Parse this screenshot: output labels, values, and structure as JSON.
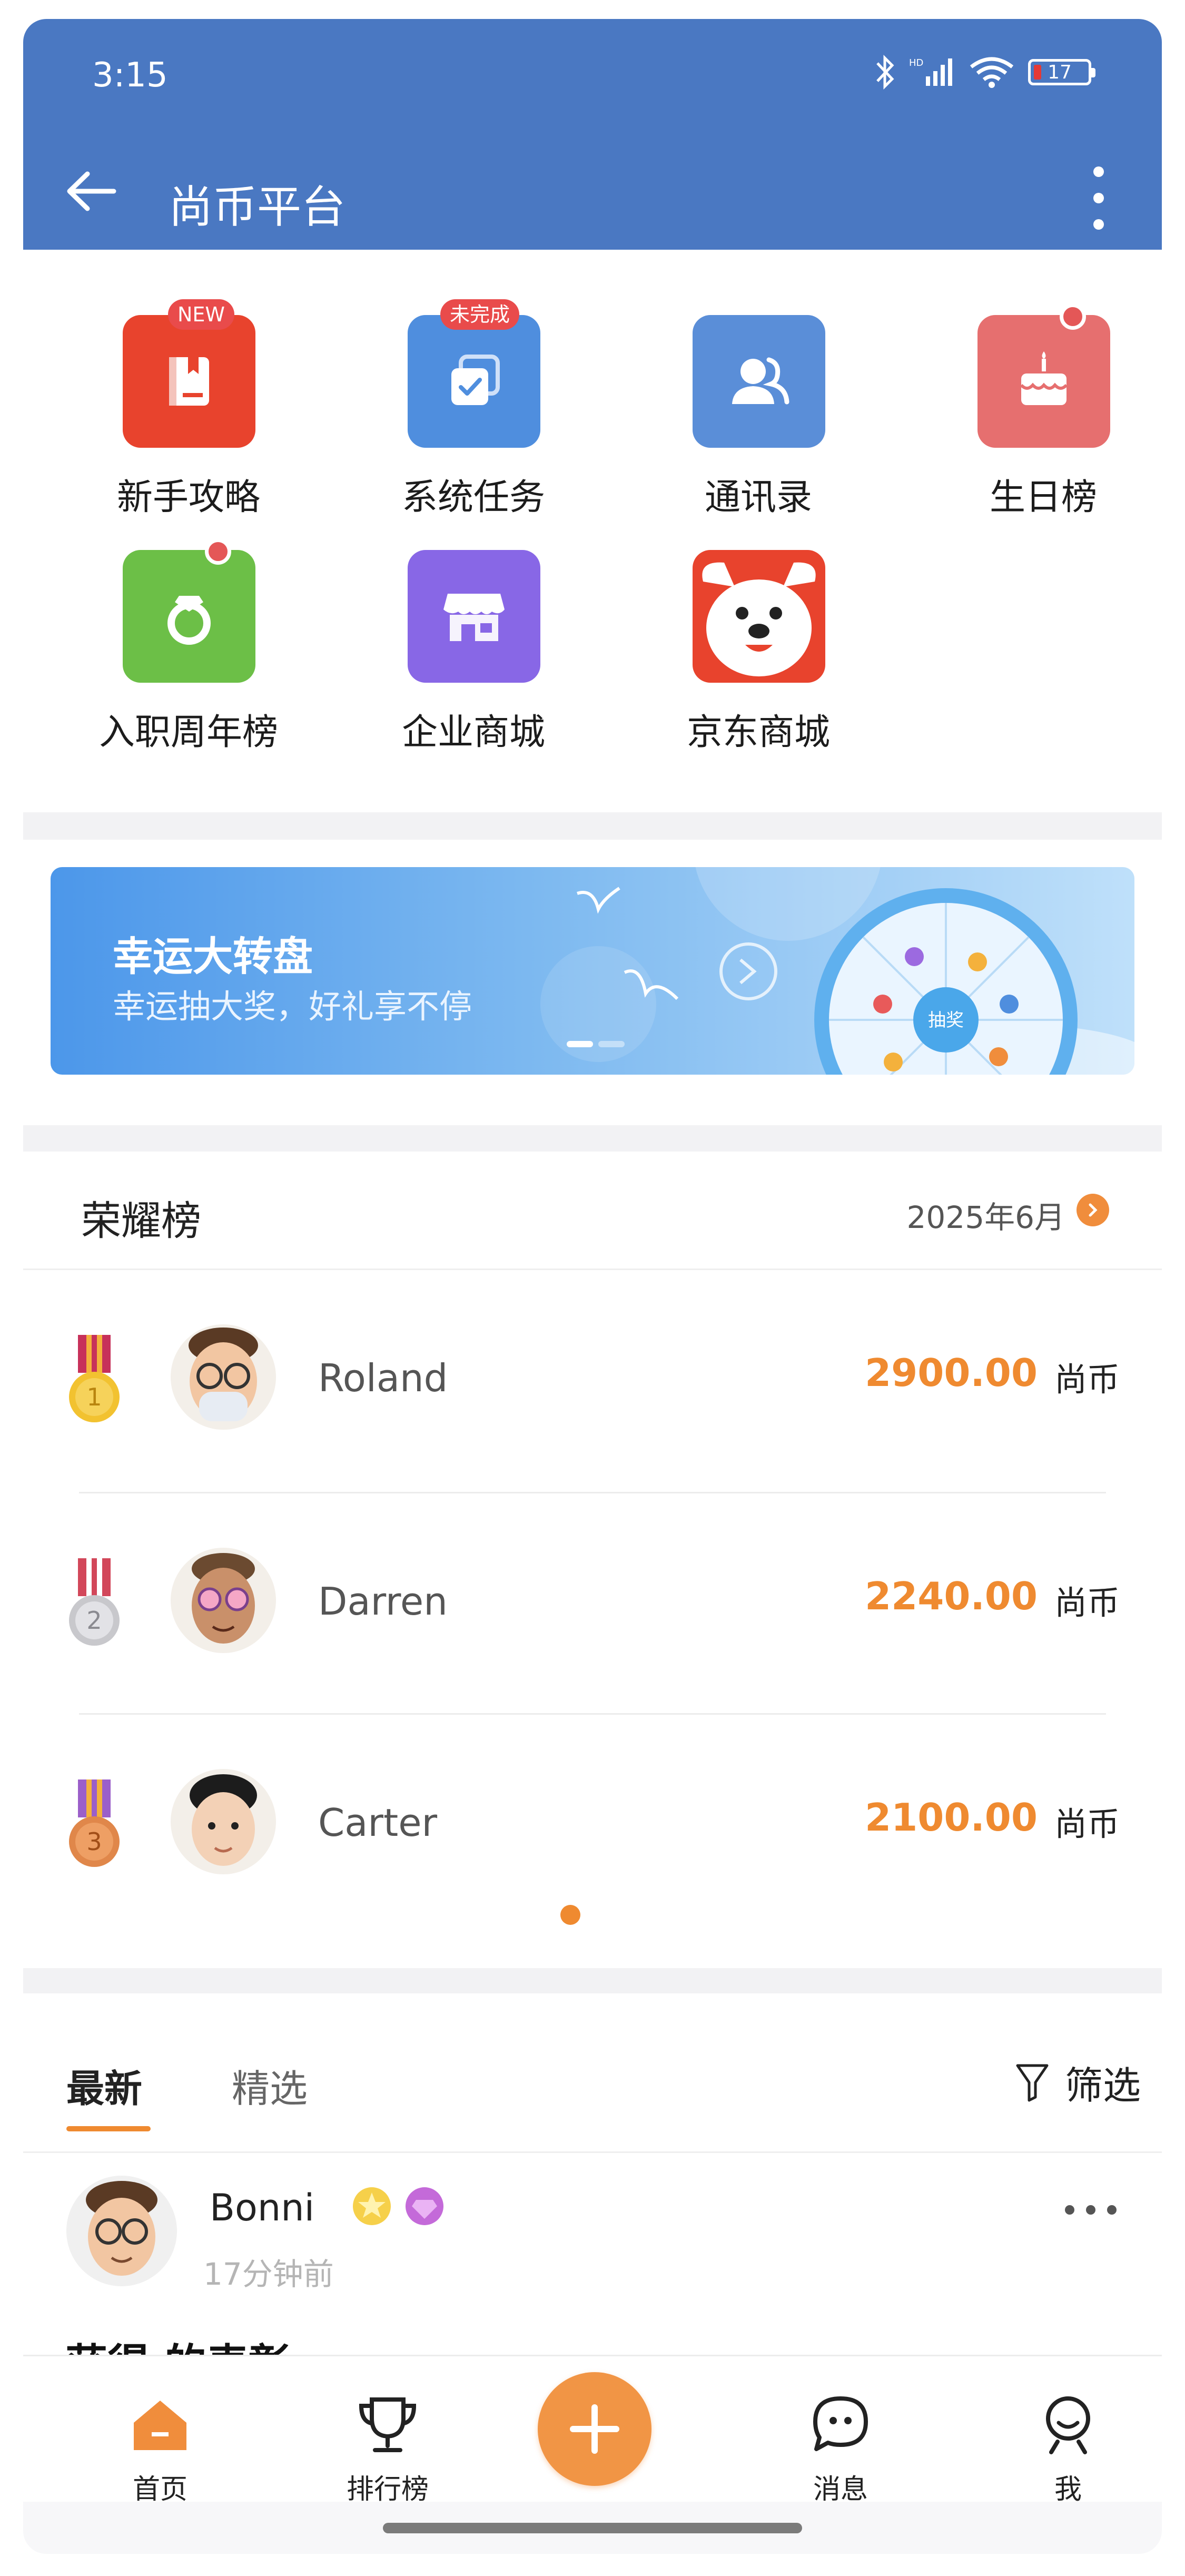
{
  "status_bar": {
    "time": "3:15",
    "battery": "17"
  },
  "app_bar": {
    "title": "尚币平台"
  },
  "grid": [
    {
      "label": "新手攻略",
      "badge": "NEW",
      "color": "#e8432d",
      "icon": "book-icon"
    },
    {
      "label": "系统任务",
      "badge": "未完成",
      "color": "#4f8ede",
      "icon": "task-icon"
    },
    {
      "label": "通讯录",
      "badge": "",
      "color": "#5a8ed8",
      "icon": "contacts-icon"
    },
    {
      "label": "生日榜",
      "badge": "",
      "color": "#e66f6f",
      "icon": "cake-icon",
      "dot": true
    },
    {
      "label": "入职周年榜",
      "badge": "",
      "color": "#6cbf47",
      "icon": "ring-icon",
      "dot": true
    },
    {
      "label": "企业商城",
      "badge": "",
      "color": "#8867e6",
      "icon": "store-icon"
    },
    {
      "label": "京东商城",
      "badge": "",
      "color": "#e8432d",
      "icon": "jd-dog-icon"
    }
  ],
  "banner": {
    "title": "幸运大转盘",
    "subtitle": "幸运抽大奖，好礼享不停",
    "wheel_center": "抽奖"
  },
  "honor_board": {
    "title": "荣耀榜",
    "date": "2025年6月",
    "rows": [
      {
        "rank": 1,
        "name": "Roland",
        "amount": "2900.00",
        "unit": "尚币"
      },
      {
        "rank": 2,
        "name": "Darren",
        "amount": "2240.00",
        "unit": "尚币"
      },
      {
        "rank": 3,
        "name": "Carter",
        "amount": "2100.00",
        "unit": "尚币"
      }
    ]
  },
  "feed": {
    "tabs": [
      "最新",
      "精选"
    ],
    "filter_label": "筛选",
    "post": {
      "name": "Bonni",
      "time": "17分钟前",
      "content": "获得 的表彰"
    }
  },
  "bottom_nav": [
    {
      "label": "首页",
      "icon": "home-icon"
    },
    {
      "label": "排行榜",
      "icon": "trophy-icon"
    },
    {
      "label": "",
      "icon": "plus-icon"
    },
    {
      "label": "消息",
      "icon": "message-icon"
    },
    {
      "label": "我",
      "icon": "profile-icon"
    }
  ],
  "colors": {
    "primary": "#4a78c2",
    "accent": "#ef8a30"
  }
}
